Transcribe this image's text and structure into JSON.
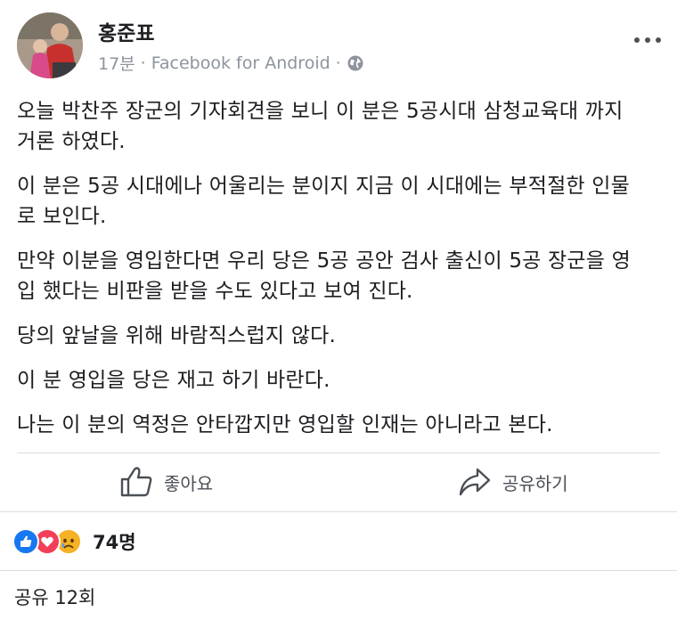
{
  "post": {
    "author": "홍준표",
    "time": "17분",
    "separator": "·",
    "source": "Facebook for Android",
    "privacy_icon": "globe-icon",
    "paragraphs": [
      "오늘 박찬주 장군의 기자회견을 보니 이 분은 5공시대 삼청교육대 까지\n거론 하였다.",
      "이 분은 5공 시대에나 어울리는 분이지 지금 이 시대에는 부적절한 인물\n로 보인다.",
      "만약 이분을 영입한다면 우리 당은 5공 공안 검사 출신이 5공 장군을 영\n입 했다는 비판을 받을 수도 있다고 보여 진다.",
      "당의 앞날을 위해 바람직스럽지 않다.",
      "이 분 영입을 당은 재고 하기 바란다.",
      "나는 이 분의 역정은 안타깝지만 영입할 인재는 아니라고 본다."
    ]
  },
  "actions": {
    "like_label": "좋아요",
    "share_label": "공유하기"
  },
  "reactions": {
    "icons": [
      "like-reaction-icon",
      "love-reaction-icon",
      "sad-reaction-icon"
    ],
    "count": "74명"
  },
  "shares": {
    "label": "공유 12회"
  },
  "colors": {
    "text": "#1c1e21",
    "meta": "#8d949e",
    "action": "#4b4f56",
    "like_blue": "#1877f2",
    "love_red": "#f33e58",
    "sad_yellow": "#f7b125",
    "divider": "#dadde1"
  }
}
